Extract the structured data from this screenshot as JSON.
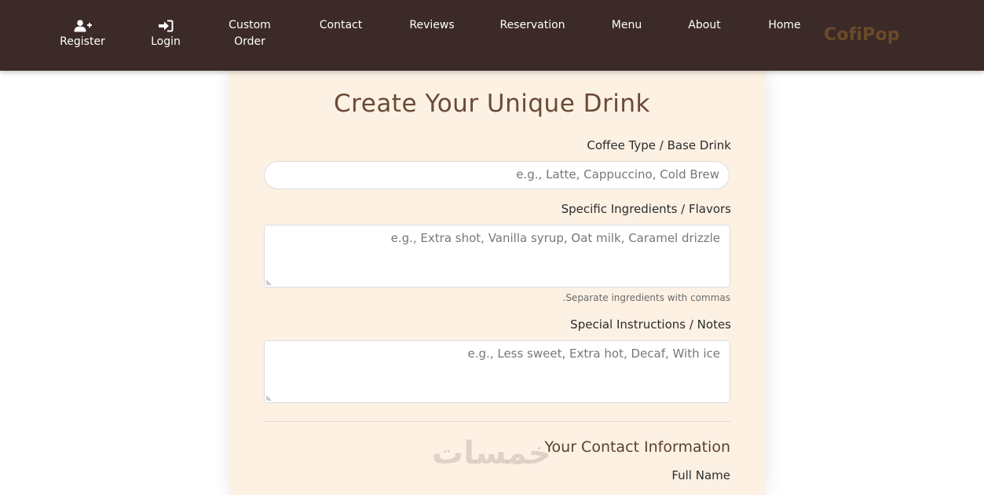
{
  "nav": {
    "brand": "CofiPop",
    "items": [
      {
        "label": "Home"
      },
      {
        "label": "About"
      },
      {
        "label": "Menu"
      },
      {
        "label": "Reservation"
      },
      {
        "label": "Reviews"
      },
      {
        "label": "Contact"
      },
      {
        "label": "Custom Order"
      },
      {
        "label": "Login",
        "icon": "sign-in-icon"
      },
      {
        "label": "Register",
        "icon": "user-plus-icon"
      }
    ]
  },
  "form": {
    "title": "Create Your Unique Drink",
    "coffee_type": {
      "label": "Coffee Type / Base Drink",
      "placeholder": "e.g., Latte, Cappuccino, Cold Brew"
    },
    "ingredients": {
      "label": "Specific Ingredients / Flavors",
      "placeholder": "e.g., Extra shot, Vanilla syrup, Oat milk, Caramel drizzle",
      "hint": ".Separate ingredients with commas"
    },
    "instructions": {
      "label": "Special Instructions / Notes",
      "placeholder": "e.g., Less sweet, Extra hot, Decaf, With ice"
    },
    "contact_section": {
      "title": "Your Contact Information",
      "full_name_label": "Full Name"
    }
  },
  "watermark": "خمسات",
  "colors": {
    "navbar_bg": "#3b2a27",
    "brand": "#6b4a2b",
    "card_bg": "#fdf1e4",
    "title": "#6a4a36"
  }
}
